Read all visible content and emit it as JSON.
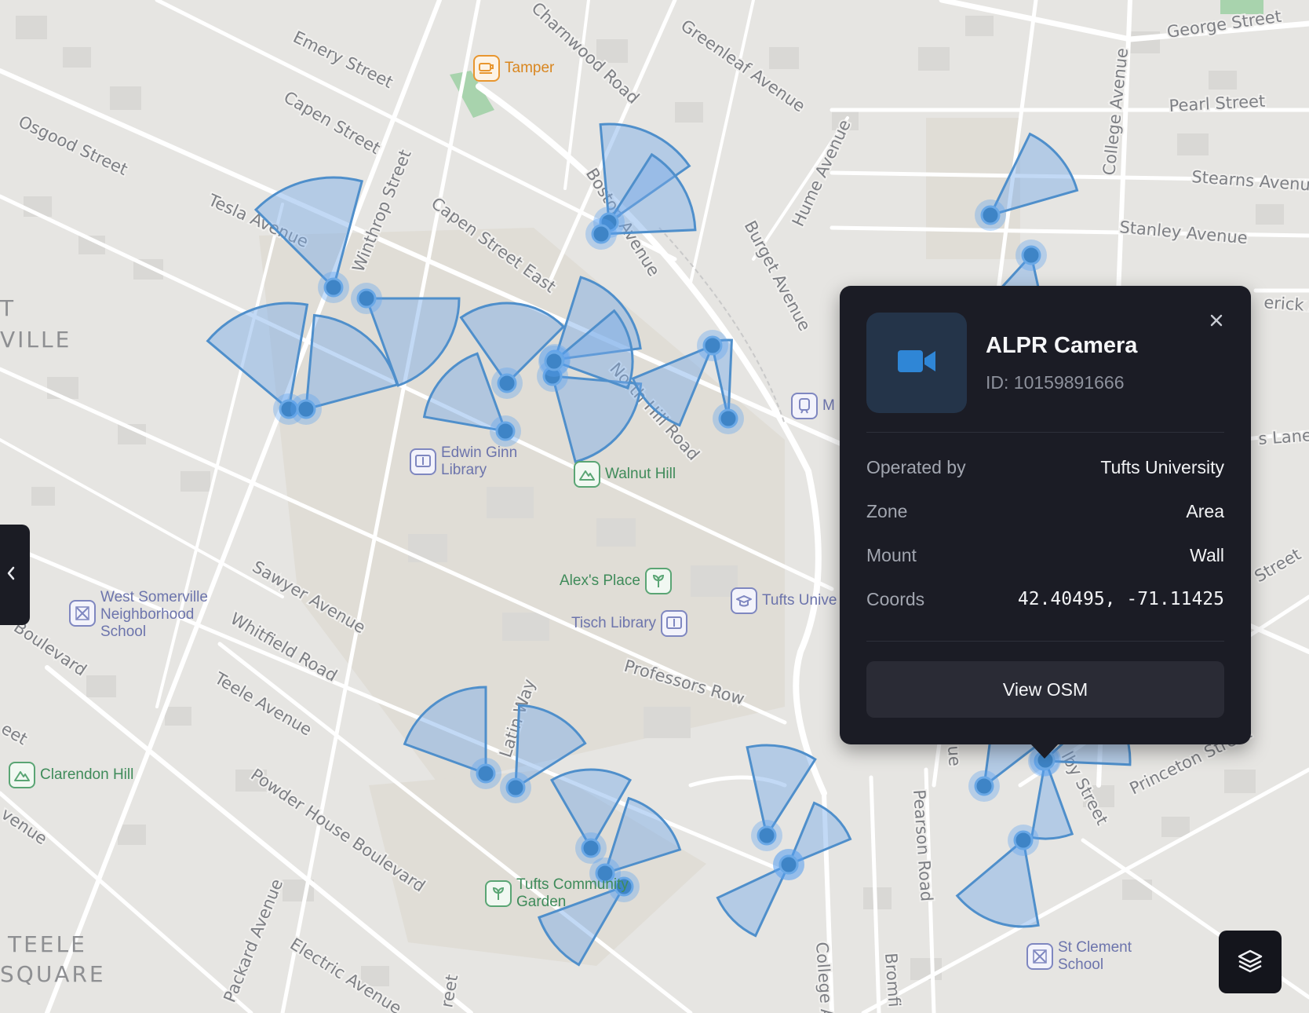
{
  "map": {
    "streets": [
      "Emery Street",
      "Capen Street",
      "Osgood Street",
      "Tesla Avenue",
      "Winthrop Street",
      "Capen Street East",
      "Boston Avenue",
      "Charnwood Road",
      "Greenleaf Avenue",
      "Hume Avenue",
      "Burget Avenue",
      "College Avenue",
      "George Street",
      "Pearl Street",
      "Stearns Avenue",
      "Stanley Avenue",
      "North Hill Road",
      "Sawyer Avenue",
      "Whitfield Road",
      "Teele Avenue",
      "Powder House Boulevard",
      "Professors Row",
      "Latin Way",
      "Packard Avenue",
      "Electric Avenue",
      "Pearson Road",
      "Princeton Street",
      "Boulevard",
      "Street",
      "erick A",
      "s Lane",
      "eet",
      "venue",
      "Bromfi",
      "College A",
      "reet",
      "ue",
      "lby Street"
    ],
    "areas": [
      "T",
      "VILLE",
      "TEELE",
      "SQUARE"
    ],
    "pois": [
      {
        "name": "Tamper",
        "type": "food",
        "icon": "cafe-icon"
      },
      {
        "name": "Edwin Ginn Library",
        "type": "edu",
        "icon": "library-icon"
      },
      {
        "name": "Walnut Hill",
        "type": "park",
        "icon": "hill-icon"
      },
      {
        "name": "Alex's Place",
        "type": "park",
        "icon": "garden-icon"
      },
      {
        "name": "Tisch Library",
        "type": "edu",
        "icon": "library-icon"
      },
      {
        "name": "Tufts Unive",
        "type": "edu",
        "icon": "university-icon"
      },
      {
        "name": "M",
        "type": "edu",
        "icon": "train-icon"
      },
      {
        "name": "West Somerville Neighborhood School",
        "type": "edu",
        "icon": "school-icon"
      },
      {
        "name": "Clarendon Hill",
        "type": "park",
        "icon": "hill-icon"
      },
      {
        "name": "Tufts Community Garden",
        "type": "park",
        "icon": "garden-icon"
      },
      {
        "name": "St Clement School",
        "type": "edu",
        "icon": "school-icon"
      }
    ]
  },
  "popup": {
    "title": "ALPR Camera",
    "id_text": "ID: 10159891666",
    "icon": "video-camera-icon",
    "props": [
      {
        "label": "Operated by",
        "value": "Tufts University"
      },
      {
        "label": "Zone",
        "value": "Area"
      },
      {
        "label": "Mount",
        "value": "Wall"
      },
      {
        "label": "Coords",
        "value": "42.40495, -71.11425"
      }
    ],
    "button": "View OSM"
  },
  "controls": {
    "sidebar_toggle_icon": "chevron-left-icon",
    "layers_icon": "layers-icon"
  },
  "colors": {
    "camera_fill": "#78aae8",
    "camera_stroke": "#4f8fcb",
    "popup_bg": "#1b1c25",
    "accent": "#2f86d6"
  }
}
